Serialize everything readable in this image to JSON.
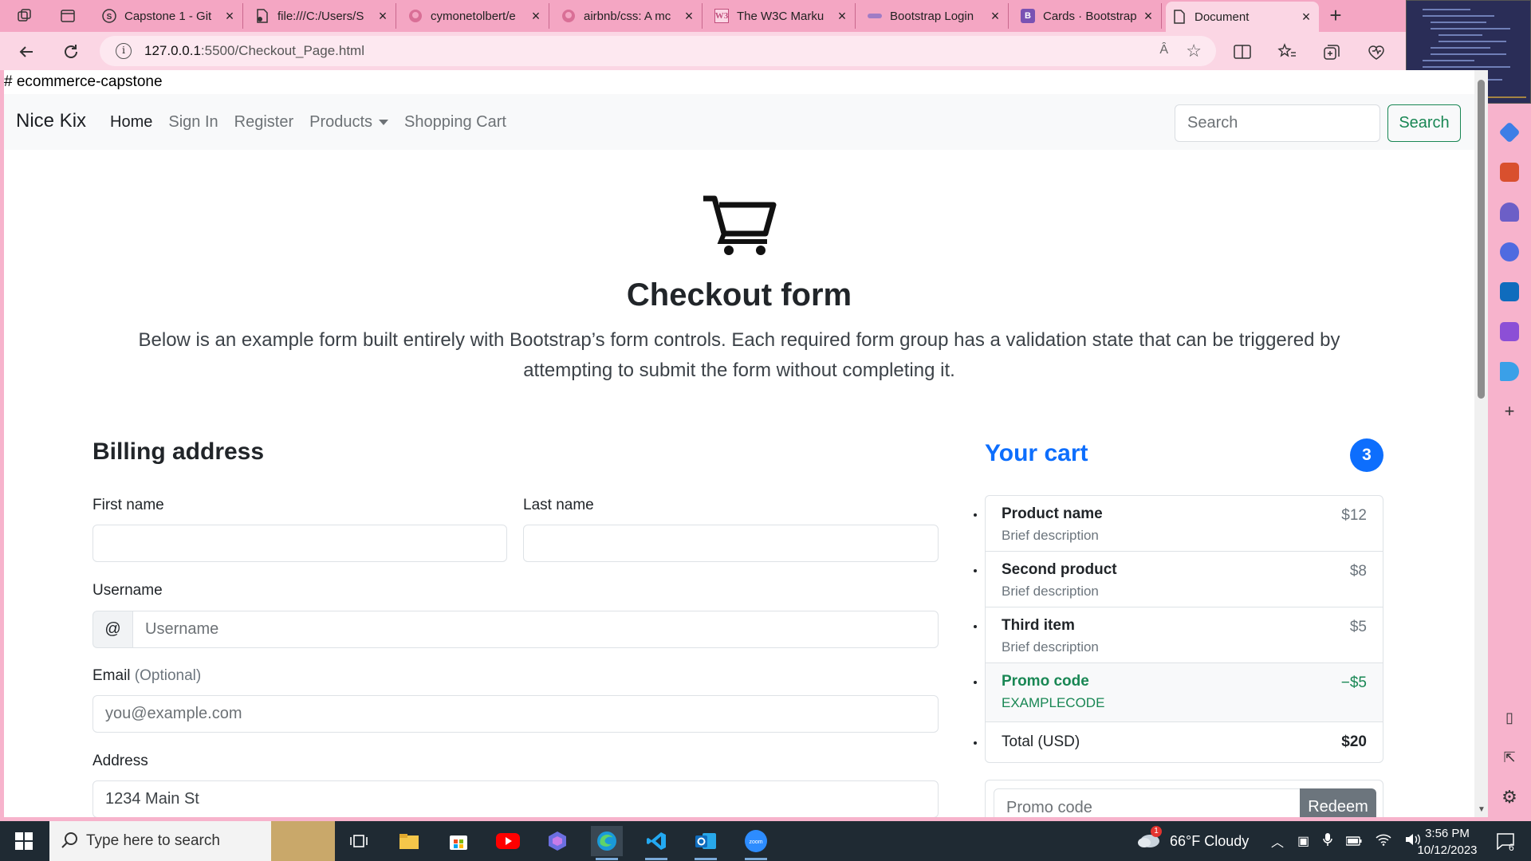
{
  "browser": {
    "tabs": [
      {
        "label": "Capstone 1 - Git",
        "icon": "github-s-icon"
      },
      {
        "label": "file:///C:/Users/S",
        "icon": "pdf-icon"
      },
      {
        "label": "cymonetolbert/e",
        "icon": "github-icon"
      },
      {
        "label": "airbnb/css: A mc",
        "icon": "github-icon"
      },
      {
        "label": "The W3C Marku",
        "icon": "w3c-icon"
      },
      {
        "label": "Bootstrap Login",
        "icon": "bootstrap-purple-icon"
      },
      {
        "label": "Cards · Bootstrap",
        "icon": "bootstrap-icon"
      },
      {
        "label": "Document",
        "icon": "document-icon",
        "active": true
      }
    ],
    "url_host": "127.0.0.1",
    "url_rest": ":5500/Checkout_Page.html",
    "read_aloud_label": "Ȃ"
  },
  "page": {
    "md_heading": "# ecommerce-capstone",
    "navbar": {
      "brand": "Nice Kix",
      "links": [
        "Home",
        "Sign In",
        "Register",
        "Products",
        "Shopping Cart"
      ],
      "search_placeholder": "Search",
      "search_button": "Search"
    },
    "hero": {
      "title": "Checkout form",
      "lead": "Below is an example form built entirely with Bootstrap’s form controls. Each required form group has a validation state that can be triggered by attempting to submit the form without completing it."
    },
    "billing": {
      "title": "Billing address",
      "first_name_label": "First name",
      "last_name_label": "Last name",
      "username_label": "Username",
      "username_prefix": "@",
      "username_placeholder": "Username",
      "email_label": "Email",
      "email_optional": "(Optional)",
      "email_placeholder": "you@example.com",
      "address_label": "Address",
      "address_placeholder": "1234 Main St"
    },
    "cart": {
      "title": "Your cart",
      "count": "3",
      "items": [
        {
          "name": "Product name",
          "desc": "Brief description",
          "price": "$12"
        },
        {
          "name": "Second product",
          "desc": "Brief description",
          "price": "$8"
        },
        {
          "name": "Third item",
          "desc": "Brief description",
          "price": "$5"
        }
      ],
      "promo": {
        "name": "Promo code",
        "code": "EXAMPLECODE",
        "amount": "−$5"
      },
      "total_label": "Total (USD)",
      "total_value": "$20",
      "promo_placeholder": "Promo code",
      "redeem_button": "Redeem"
    }
  },
  "taskbar": {
    "search_placeholder": "Type here to search",
    "weather": "66°F  Cloudy",
    "weather_badge": "1",
    "time": "3:56 PM",
    "date": "10/12/2023",
    "notifications": "6"
  },
  "colors": {
    "accent_blue": "#0d6efd",
    "success_green": "#198754",
    "browser_pink": "#f4a6c3"
  }
}
